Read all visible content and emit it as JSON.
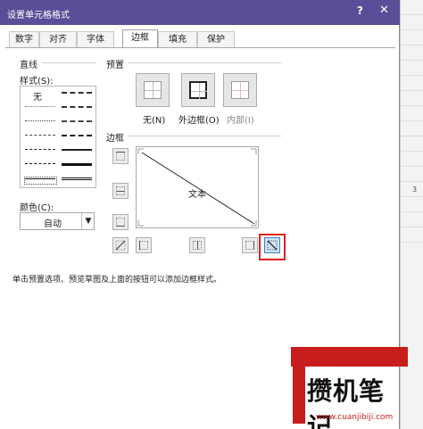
{
  "window": {
    "title": "设置单元格格式",
    "help": "?",
    "close": "✕"
  },
  "tabs": [
    {
      "label": "数字",
      "active": false
    },
    {
      "label": "对齐",
      "active": false
    },
    {
      "label": "字体",
      "active": false
    },
    {
      "label": "边框",
      "active": true
    },
    {
      "label": "填充",
      "active": false
    },
    {
      "label": "保护",
      "active": false
    }
  ],
  "line_group": {
    "title": "直线",
    "style_label": "样式(S):",
    "none_label": "无",
    "color_label": "颜色(C):",
    "color_value": "自动"
  },
  "presets": {
    "title": "预置",
    "items": [
      {
        "label": "无(N)",
        "icon": "no-border-icon"
      },
      {
        "label": "外边框(O)",
        "icon": "outline-border-icon"
      },
      {
        "label": "内部(I)",
        "icon": "inside-border-icon"
      }
    ]
  },
  "border": {
    "title": "边框",
    "preview_text": "文本",
    "buttons": [
      "top-border-icon",
      "middle-horizontal-border-icon",
      "bottom-border-icon",
      "diagonal-up-border-icon",
      "left-border-icon",
      "middle-vertical-border-icon",
      "right-border-icon",
      "diagonal-down-border-icon"
    ]
  },
  "hint": "单击预置选项、预览草图及上面的按钮可以添加边框样式。",
  "background": {
    "cell_text": "3"
  },
  "watermark": {
    "brand": "攒机笔记",
    "url": "www.cuanjibiji.com"
  },
  "colors": {
    "titlebar": "#5b4d97",
    "highlight": "#e02020",
    "watermark_red": "#c81d1d"
  }
}
